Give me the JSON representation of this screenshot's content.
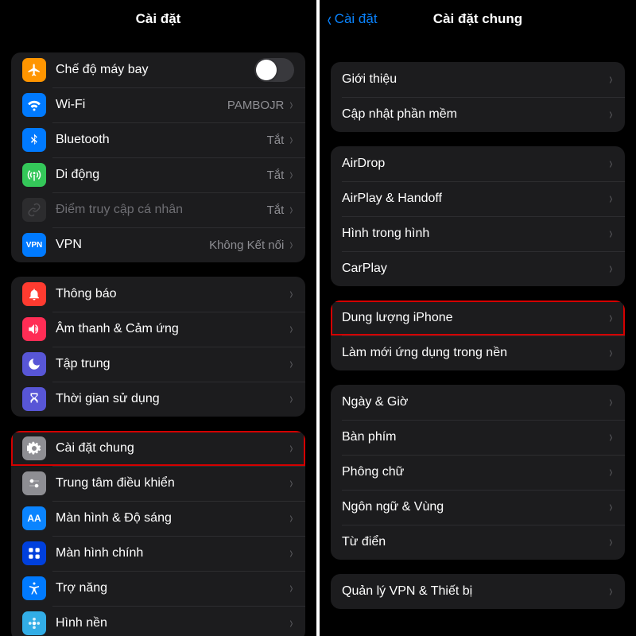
{
  "left": {
    "title": "Cài đặt",
    "group1": {
      "airplane": {
        "label": "Chế độ máy bay"
      },
      "wifi": {
        "label": "Wi-Fi",
        "value": "PAMBOJR"
      },
      "bluetooth": {
        "label": "Bluetooth",
        "value": "Tắt"
      },
      "cellular": {
        "label": "Di động",
        "value": "Tắt"
      },
      "hotspot": {
        "label": "Điểm truy cập cá nhân",
        "value": "Tắt"
      },
      "vpn": {
        "label": "VPN",
        "value": "Không Kết nối"
      }
    },
    "group2": {
      "notifications": {
        "label": "Thông báo"
      },
      "sounds": {
        "label": "Âm thanh & Cảm ứng"
      },
      "focus": {
        "label": "Tập trung"
      },
      "screentime": {
        "label": "Thời gian sử dụng"
      }
    },
    "group3": {
      "general": {
        "label": "Cài đặt chung"
      },
      "control": {
        "label": "Trung tâm điều khiển"
      },
      "display": {
        "label": "Màn hình & Độ sáng"
      },
      "home": {
        "label": "Màn hình chính"
      },
      "accessibility": {
        "label": "Trợ năng"
      },
      "wallpaper": {
        "label": "Hình nền"
      }
    }
  },
  "right": {
    "back": "Cài đặt",
    "title": "Cài đặt chung",
    "group1": {
      "about": {
        "label": "Giới thiệu"
      },
      "update": {
        "label": "Cập nhật phần mềm"
      }
    },
    "group2": {
      "airdrop": {
        "label": "AirDrop"
      },
      "airplay": {
        "label": "AirPlay & Handoff"
      },
      "pip": {
        "label": "Hình trong hình"
      },
      "carplay": {
        "label": "CarPlay"
      }
    },
    "group3": {
      "storage": {
        "label": "Dung lượng iPhone"
      },
      "bgapp": {
        "label": "Làm mới ứng dụng trong nền"
      }
    },
    "group4": {
      "datetime": {
        "label": "Ngày & Giờ"
      },
      "keyboard": {
        "label": "Bàn phím"
      },
      "fonts": {
        "label": "Phông chữ"
      },
      "lang": {
        "label": "Ngôn ngữ & Vùng"
      },
      "dict": {
        "label": "Từ điển"
      }
    },
    "group5": {
      "vpn": {
        "label": "Quản lý VPN & Thiết bị"
      }
    }
  }
}
